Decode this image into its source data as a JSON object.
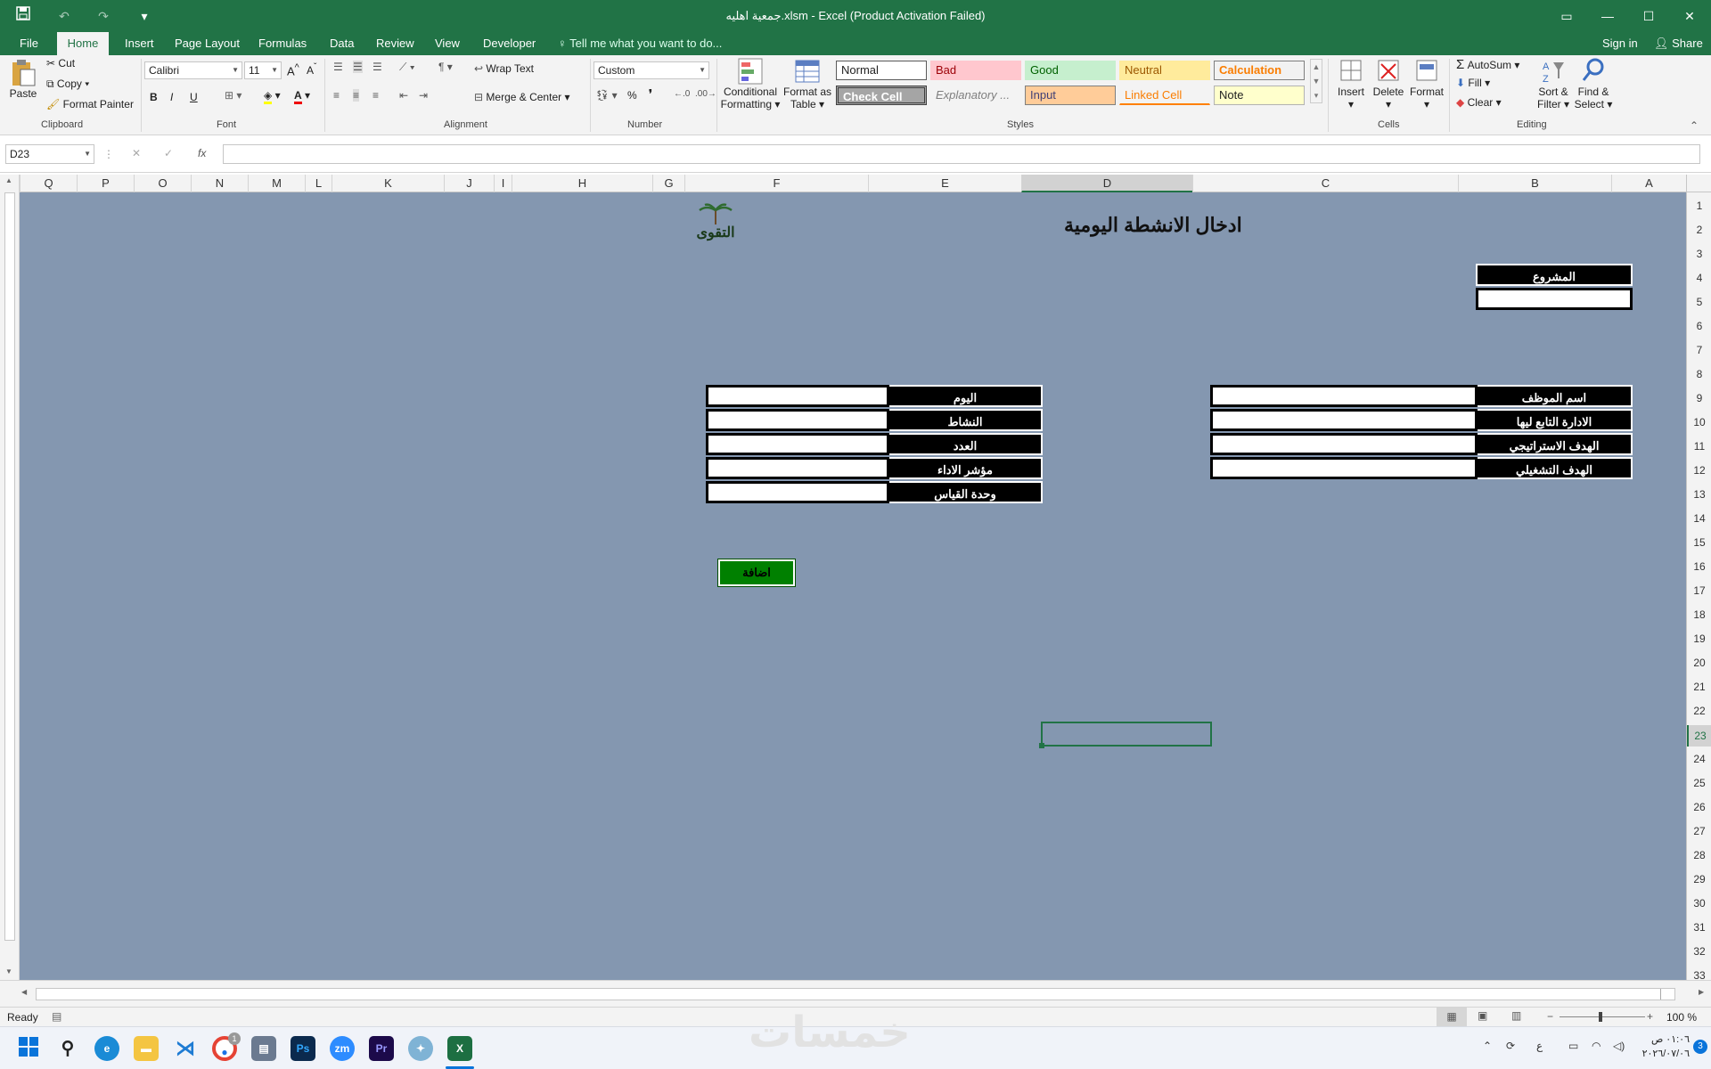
{
  "window": {
    "title": "جمعية اهليه.xlsm - Excel (Product Activation Failed)"
  },
  "tabs": [
    "File",
    "Home",
    "Insert",
    "Page Layout",
    "Formulas",
    "Data",
    "Review",
    "View",
    "Developer"
  ],
  "tell_me": "Tell me what you want to do...",
  "account": {
    "signin": "Sign in",
    "share": "Share"
  },
  "clipboard": {
    "paste": "Paste",
    "cut": "Cut",
    "copy": "Copy",
    "format_painter": "Format Painter",
    "label": "Clipboard"
  },
  "font": {
    "name": "Calibri",
    "size": "11",
    "bold": "B",
    "italic": "I",
    "underline": "U",
    "label": "Font"
  },
  "alignment": {
    "wrap": "Wrap Text",
    "merge": "Merge & Center",
    "label": "Alignment"
  },
  "number": {
    "format": "Custom",
    "percent": "%",
    "comma": "❜",
    "label": "Number"
  },
  "styles": {
    "conditional": [
      "Conditional",
      "Formatting"
    ],
    "format_table": [
      "Format as",
      "Table"
    ],
    "cells": [
      "Normal",
      "Bad",
      "Good",
      "Neutral",
      "Calculation",
      "Check Cell",
      "Explanatory ...",
      "Input",
      "Linked Cell",
      "Note"
    ],
    "label": "Styles"
  },
  "cells_grp": {
    "insert": "Insert",
    "delete": "Delete",
    "format": "Format",
    "label": "Cells"
  },
  "editing": {
    "autosum": "AutoSum",
    "fill": "Fill",
    "clear": "Clear",
    "sort": [
      "Sort &",
      "Filter"
    ],
    "find": [
      "Find &",
      "Select"
    ],
    "label": "Editing"
  },
  "formula_bar": {
    "name_box": "D23",
    "fx": "fx",
    "value": ""
  },
  "columns": [
    "Q",
    "P",
    "O",
    "N",
    "M",
    "L",
    "K",
    "J",
    "I",
    "H",
    "G",
    "F",
    "E",
    "D",
    "C",
    "B",
    "A"
  ],
  "rows": [
    "1",
    "2",
    "3",
    "4",
    "5",
    "6",
    "7",
    "8",
    "9",
    "10",
    "11",
    "12",
    "13",
    "14",
    "15",
    "16",
    "17",
    "18",
    "19",
    "20",
    "21",
    "22",
    "23",
    "24",
    "25",
    "26",
    "27",
    "28",
    "29",
    "30",
    "31",
    "32",
    "33"
  ],
  "sheet": {
    "heading": "ادخال الانشطة اليومية",
    "logo_text": "التقوى",
    "project_label": "المشروع",
    "left_labels": [
      "اسم الموظف",
      "الادارة التابع ليها",
      "الهدف الاستراتيجي",
      "الهدف التشغيلي"
    ],
    "right_labels": [
      "اليوم",
      "النشاط",
      "العدد",
      "مؤشر الاداء",
      "وحدة القياس"
    ],
    "add_button": "اضافة"
  },
  "status": {
    "ready": "Ready",
    "zoom": "100 %"
  },
  "taskbar": {
    "time": "٠١:٠٦ ص",
    "date": "٢٠٢٦/٠٧/٠٦",
    "lang": "ع",
    "notifications": "3",
    "chrome_badge": "1"
  },
  "watermark": "خمسات",
  "colors": {
    "excel_green": "#217346",
    "sheet_bg": "#8497b0",
    "button_green": "#008000"
  }
}
